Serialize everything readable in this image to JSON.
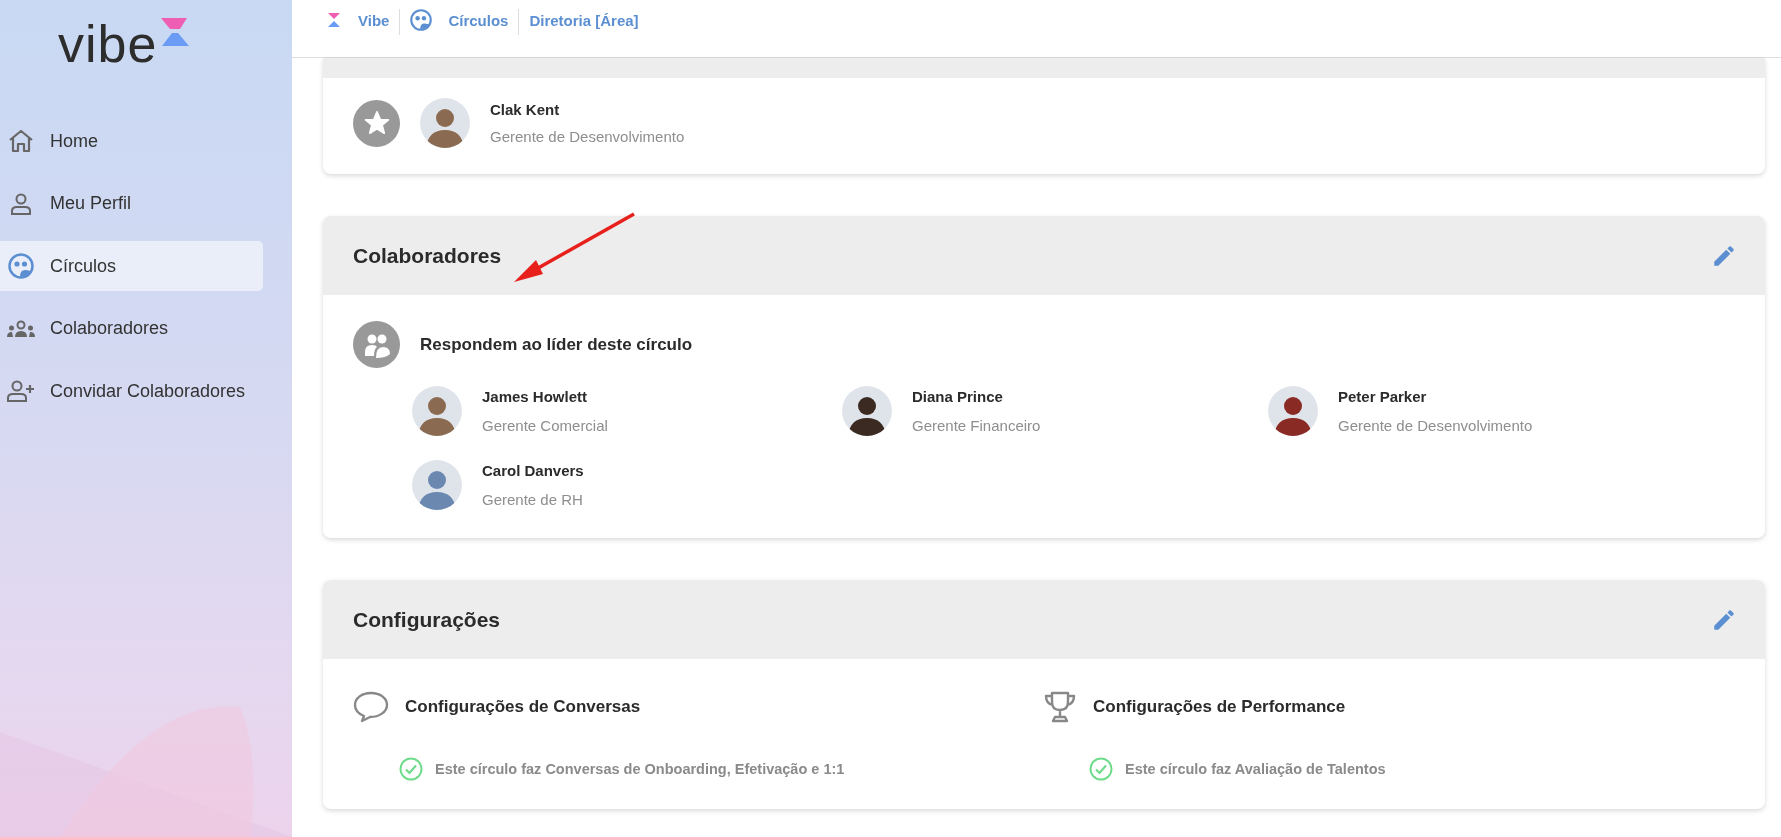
{
  "sidebar": {
    "logo": "vibe",
    "items": [
      {
        "label": "Home",
        "kind": "home",
        "selected": false
      },
      {
        "label": "Meu Perfil",
        "kind": "person",
        "selected": false
      },
      {
        "label": "Círculos",
        "kind": "circles",
        "selected": true
      },
      {
        "label": "Colaboradores",
        "kind": "group",
        "selected": false
      },
      {
        "label": "Convidar Colaboradores",
        "kind": "person-add",
        "selected": false
      }
    ]
  },
  "breadcrumb": [
    {
      "label": "Vibe",
      "kind": "logo"
    },
    {
      "label": "Círculos",
      "kind": "circles"
    },
    {
      "label": "Diretoria [Área]",
      "kind": "plain"
    }
  ],
  "leader": {
    "name": "Clak Kent",
    "role": "Gerente de Desenvolvimento"
  },
  "collaborators": {
    "title": "Colaboradores",
    "subtitle": "Respondem ao líder deste círculo",
    "members": [
      {
        "name": "James Howlett",
        "role": "Gerente Comercial"
      },
      {
        "name": "Diana Prince",
        "role": "Gerente Financeiro"
      },
      {
        "name": "Peter Parker",
        "role": "Gerente de Desenvolvimento"
      },
      {
        "name": "Carol Danvers",
        "role": "Gerente de RH"
      }
    ]
  },
  "settings": {
    "title": "Configurações",
    "sections": [
      {
        "kind": "chat",
        "title": "Configurações de Conversas",
        "items": [
          {
            "label": "Este círculo faz Conversas de Onboarding, Efetivação e 1:1",
            "checked": true
          }
        ]
      },
      {
        "kind": "trophy",
        "title": "Configurações de Performance",
        "items": [
          {
            "label": "Este círculo faz Avaliação de Talentos",
            "checked": true
          }
        ]
      }
    ]
  }
}
